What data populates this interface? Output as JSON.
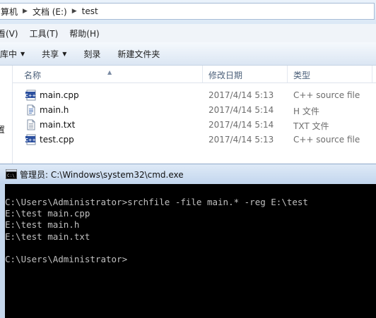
{
  "explorer": {
    "breadcrumb": [
      "算机",
      "文档 (E:)",
      "test"
    ],
    "menu": [
      "看(V)",
      "工具(T)",
      "帮助(H)"
    ],
    "toolbar": {
      "include": "库中",
      "share": "共享",
      "burn": "刻录",
      "new_folder": "新建文件夹"
    },
    "nav_pane_text": "置",
    "columns": {
      "name": "名称",
      "date": "修改日期",
      "type": "类型"
    },
    "files": [
      {
        "name": "main.cpp",
        "date": "2017/4/14 5:13",
        "type": "C++ source file",
        "icon": "cpp-file-icon"
      },
      {
        "name": "main.h",
        "date": "2017/4/14 5:14",
        "type": "H 文件",
        "icon": "header-file-icon"
      },
      {
        "name": "main.txt",
        "date": "2017/4/14 5:14",
        "type": "TXT 文件",
        "icon": "text-file-icon"
      },
      {
        "name": "test.cpp",
        "date": "2017/4/14 5:13",
        "type": "C++ source file",
        "icon": "cpp-file-icon"
      }
    ]
  },
  "cmd": {
    "title": "管理员: C:\\Windows\\system32\\cmd.exe",
    "lines": [
      "C:\\Users\\Administrator>srchfile -file main.* -reg E:\\test",
      "E:\\test main.cpp",
      "E:\\test main.h",
      "E:\\test main.txt",
      "",
      "C:\\Users\\Administrator>"
    ]
  }
}
